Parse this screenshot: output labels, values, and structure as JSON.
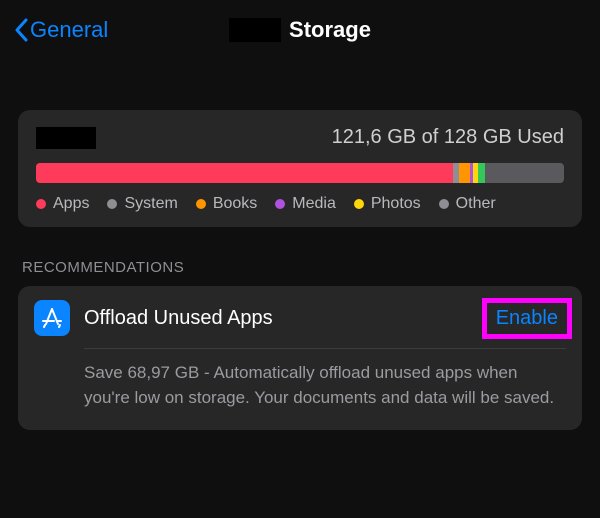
{
  "nav": {
    "back_label": "General",
    "title": "Storage"
  },
  "storage": {
    "used_text": "121,6 GB of 128 GB Used",
    "segments": [
      {
        "name": "Apps",
        "color": "#ff3b5c",
        "pct": 79
      },
      {
        "name": "System",
        "color": "#8e8e93",
        "pct": 1.2
      },
      {
        "name": "Books",
        "color": "#ff9500",
        "pct": 2
      },
      {
        "name": "Media",
        "color": "#af52de",
        "pct": 0.6
      },
      {
        "name": "Photos",
        "color": "#ffd60a",
        "pct": 1
      },
      {
        "name": "Other",
        "color": "#34c759",
        "pct": 1.2
      }
    ],
    "free_pct": 15,
    "legend": [
      {
        "label": "Apps",
        "color": "#ff3b5c"
      },
      {
        "label": "System",
        "color": "#8e8e93"
      },
      {
        "label": "Books",
        "color": "#ff9500"
      },
      {
        "label": "Media",
        "color": "#af52de"
      },
      {
        "label": "Photos",
        "color": "#ffd60a"
      },
      {
        "label": "Other",
        "color": "#8e8e93"
      }
    ]
  },
  "recommendations": {
    "header": "RECOMMENDATIONS",
    "item": {
      "title": "Offload Unused Apps",
      "action": "Enable",
      "description": "Save 68,97 GB - Automatically offload unused apps when you're low on storage. Your documents and data will be saved."
    }
  }
}
